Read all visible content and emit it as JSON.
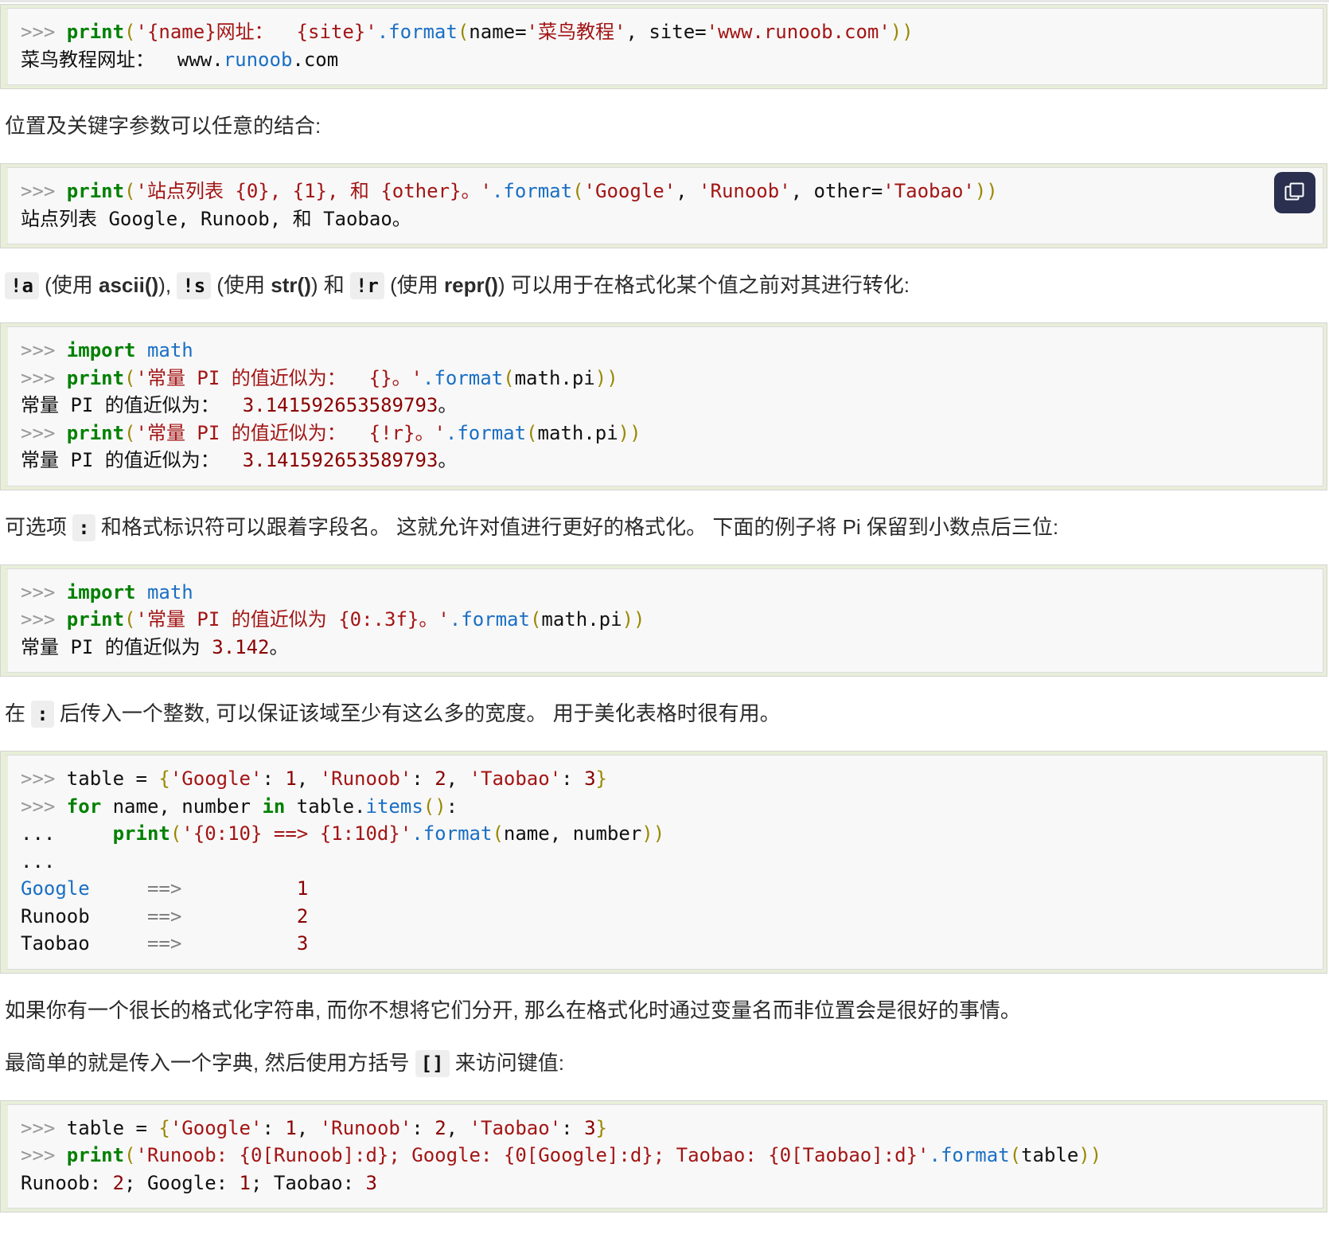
{
  "page": {
    "title": "Python format 字符串格式化教程片段",
    "background": "#ffffff",
    "code_block_frame_color": "#e8eed8",
    "code_block_inner_color": "#f8f8f8",
    "accent_copy_button_color": "#2b3050"
  },
  "colors": {
    "prompt": "#999999",
    "keyword": "#008000",
    "string": "#a31515",
    "method": "#1a6fc4",
    "paren": "#998800",
    "number": "#8b0000",
    "arrow": "#808080",
    "link": "#1a6fc4",
    "inline_code_bg": "#eeeeee"
  },
  "blocks": [
    {
      "id": "code-1",
      "type": "code",
      "has_copy_button": false,
      "lines": [
        {
          "tokens": [
            {
              "t": ">>> ",
              "c": "prompt"
            },
            {
              "t": "print",
              "c": "fn"
            },
            {
              "t": "(",
              "c": "paren"
            },
            {
              "t": "'{name}网址：  {site}'",
              "c": "str"
            },
            {
              "t": ".format",
              "c": "meth"
            },
            {
              "t": "(",
              "c": "paren"
            },
            {
              "t": "name=",
              "c": "plain"
            },
            {
              "t": "'菜鸟教程'",
              "c": "str"
            },
            {
              "t": ", ",
              "c": "punct"
            },
            {
              "t": "site=",
              "c": "plain"
            },
            {
              "t": "'www.runoob.com'",
              "c": "str"
            },
            {
              "t": "))",
              "c": "paren"
            }
          ]
        },
        {
          "tokens": [
            {
              "t": "菜鸟教程网址：  ",
              "c": "plain"
            },
            {
              "t": "www.",
              "c": "plain"
            },
            {
              "t": "runoob",
              "c": "link"
            },
            {
              "t": ".com",
              "c": "plain"
            }
          ]
        }
      ]
    },
    {
      "id": "para-1",
      "type": "paragraph",
      "segments": [
        {
          "t": "位置及关键字参数可以任意的结合:",
          "k": "text"
        }
      ]
    },
    {
      "id": "code-2",
      "type": "code",
      "has_copy_button": true,
      "copy_icon": "copy-icon",
      "lines": [
        {
          "tokens": [
            {
              "t": ">>> ",
              "c": "prompt"
            },
            {
              "t": "print",
              "c": "fn"
            },
            {
              "t": "(",
              "c": "paren"
            },
            {
              "t": "'站点列表 {0}, {1}, 和 {other}。'",
              "c": "str"
            },
            {
              "t": ".format",
              "c": "meth"
            },
            {
              "t": "(",
              "c": "paren"
            },
            {
              "t": "'Google'",
              "c": "str"
            },
            {
              "t": ", ",
              "c": "punct"
            },
            {
              "t": "'Runoob'",
              "c": "str"
            },
            {
              "t": ", ",
              "c": "punct"
            },
            {
              "t": "other=",
              "c": "plain"
            },
            {
              "t": "'Taobao'",
              "c": "str"
            },
            {
              "t": "))",
              "c": "paren"
            }
          ]
        },
        {
          "tokens": [
            {
              "t": "站点列表 Google, Runoob, 和 Taobao。",
              "c": "plain"
            }
          ]
        }
      ]
    },
    {
      "id": "para-2",
      "type": "paragraph",
      "segments": [
        {
          "t": "!a",
          "k": "code"
        },
        {
          "t": " (使用 ",
          "k": "text"
        },
        {
          "t": "ascii()",
          "k": "bold"
        },
        {
          "t": "), ",
          "k": "text"
        },
        {
          "t": "!s",
          "k": "code"
        },
        {
          "t": " (使用 ",
          "k": "text"
        },
        {
          "t": "str()",
          "k": "bold"
        },
        {
          "t": ") 和 ",
          "k": "text"
        },
        {
          "t": "!r",
          "k": "code"
        },
        {
          "t": " (使用 ",
          "k": "text"
        },
        {
          "t": "repr()",
          "k": "bold"
        },
        {
          "t": ") 可以用于在格式化某个值之前对其进行转化:",
          "k": "text"
        }
      ]
    },
    {
      "id": "code-3",
      "type": "code",
      "has_copy_button": false,
      "lines": [
        {
          "tokens": [
            {
              "t": ">>> ",
              "c": "prompt"
            },
            {
              "t": "import",
              "c": "kw"
            },
            {
              "t": " ",
              "c": "plain"
            },
            {
              "t": "math",
              "c": "meth"
            }
          ]
        },
        {
          "tokens": [
            {
              "t": ">>> ",
              "c": "prompt"
            },
            {
              "t": "print",
              "c": "fn"
            },
            {
              "t": "(",
              "c": "paren"
            },
            {
              "t": "'常量 PI 的值近似为：  {}。'",
              "c": "str"
            },
            {
              "t": ".format",
              "c": "meth"
            },
            {
              "t": "(",
              "c": "paren"
            },
            {
              "t": "math.pi",
              "c": "plain"
            },
            {
              "t": "))",
              "c": "paren"
            }
          ]
        },
        {
          "tokens": [
            {
              "t": "常量 PI 的值近似为：  ",
              "c": "plain"
            },
            {
              "t": "3.141592653589793",
              "c": "outnum"
            },
            {
              "t": "。",
              "c": "plain"
            }
          ]
        },
        {
          "tokens": [
            {
              "t": ">>> ",
              "c": "prompt"
            },
            {
              "t": "print",
              "c": "fn"
            },
            {
              "t": "(",
              "c": "paren"
            },
            {
              "t": "'常量 PI 的值近似为：  {!r}。'",
              "c": "str"
            },
            {
              "t": ".format",
              "c": "meth"
            },
            {
              "t": "(",
              "c": "paren"
            },
            {
              "t": "math.pi",
              "c": "plain"
            },
            {
              "t": "))",
              "c": "paren"
            }
          ]
        },
        {
          "tokens": [
            {
              "t": "常量 PI 的值近似为：  ",
              "c": "plain"
            },
            {
              "t": "3.141592653589793",
              "c": "outnum"
            },
            {
              "t": "。",
              "c": "plain"
            }
          ]
        }
      ]
    },
    {
      "id": "para-3",
      "type": "paragraph",
      "segments": [
        {
          "t": "可选项 ",
          "k": "text"
        },
        {
          "t": ":",
          "k": "code"
        },
        {
          "t": " 和格式标识符可以跟着字段名。 这就允许对值进行更好的格式化。 下面的例子将 Pi 保留到小数点后三位:",
          "k": "text"
        }
      ]
    },
    {
      "id": "code-4",
      "type": "code",
      "has_copy_button": false,
      "lines": [
        {
          "tokens": [
            {
              "t": ">>> ",
              "c": "prompt"
            },
            {
              "t": "import",
              "c": "kw"
            },
            {
              "t": " ",
              "c": "plain"
            },
            {
              "t": "math",
              "c": "meth"
            }
          ]
        },
        {
          "tokens": [
            {
              "t": ">>> ",
              "c": "prompt"
            },
            {
              "t": "print",
              "c": "fn"
            },
            {
              "t": "(",
              "c": "paren"
            },
            {
              "t": "'常量 PI 的值近似为 {0:.3f}。'",
              "c": "str"
            },
            {
              "t": ".format",
              "c": "meth"
            },
            {
              "t": "(",
              "c": "paren"
            },
            {
              "t": "math.pi",
              "c": "plain"
            },
            {
              "t": "))",
              "c": "paren"
            }
          ]
        },
        {
          "tokens": [
            {
              "t": "常量 PI 的值近似为 ",
              "c": "plain"
            },
            {
              "t": "3.142",
              "c": "outnum"
            },
            {
              "t": "。",
              "c": "plain"
            }
          ]
        }
      ]
    },
    {
      "id": "para-4",
      "type": "paragraph",
      "segments": [
        {
          "t": "在 ",
          "k": "text"
        },
        {
          "t": ":",
          "k": "code"
        },
        {
          "t": " 后传入一个整数, 可以保证该域至少有这么多的宽度。 用于美化表格时很有用。",
          "k": "text"
        }
      ]
    },
    {
      "id": "code-5",
      "type": "code",
      "has_copy_button": false,
      "lines": [
        {
          "tokens": [
            {
              "t": ">>> ",
              "c": "prompt"
            },
            {
              "t": "table = ",
              "c": "plain"
            },
            {
              "t": "{",
              "c": "paren"
            },
            {
              "t": "'Google'",
              "c": "str"
            },
            {
              "t": ": ",
              "c": "punct"
            },
            {
              "t": "1",
              "c": "num"
            },
            {
              "t": ", ",
              "c": "punct"
            },
            {
              "t": "'Runoob'",
              "c": "str"
            },
            {
              "t": ": ",
              "c": "punct"
            },
            {
              "t": "2",
              "c": "num"
            },
            {
              "t": ", ",
              "c": "punct"
            },
            {
              "t": "'Taobao'",
              "c": "str"
            },
            {
              "t": ": ",
              "c": "punct"
            },
            {
              "t": "3",
              "c": "num"
            },
            {
              "t": "}",
              "c": "paren"
            }
          ]
        },
        {
          "tokens": [
            {
              "t": ">>> ",
              "c": "prompt"
            },
            {
              "t": "for",
              "c": "kw"
            },
            {
              "t": " name, number ",
              "c": "plain"
            },
            {
              "t": "in",
              "c": "kw"
            },
            {
              "t": " table.",
              "c": "plain"
            },
            {
              "t": "items",
              "c": "meth"
            },
            {
              "t": "()",
              "c": "paren"
            },
            {
              "t": ":",
              "c": "punct"
            }
          ]
        },
        {
          "tokens": [
            {
              "t": "...     ",
              "c": "plain"
            },
            {
              "t": "print",
              "c": "fn"
            },
            {
              "t": "(",
              "c": "paren"
            },
            {
              "t": "'{0:10} ==> {1:10d}'",
              "c": "str"
            },
            {
              "t": ".format",
              "c": "meth"
            },
            {
              "t": "(",
              "c": "paren"
            },
            {
              "t": "name, number",
              "c": "plain"
            },
            {
              "t": "))",
              "c": "paren"
            }
          ]
        },
        {
          "tokens": [
            {
              "t": "...",
              "c": "plain"
            }
          ]
        },
        {
          "tokens": [
            {
              "t": "Google",
              "c": "link"
            },
            {
              "t": "     ",
              "c": "plain"
            },
            {
              "t": "==>",
              "c": "arrow"
            },
            {
              "t": "          ",
              "c": "plain"
            },
            {
              "t": "1",
              "c": "outnum"
            }
          ]
        },
        {
          "tokens": [
            {
              "t": "Runoob",
              "c": "plain"
            },
            {
              "t": "     ",
              "c": "plain"
            },
            {
              "t": "==>",
              "c": "arrow"
            },
            {
              "t": "          ",
              "c": "plain"
            },
            {
              "t": "2",
              "c": "outnum"
            }
          ]
        },
        {
          "tokens": [
            {
              "t": "Taobao",
              "c": "plain"
            },
            {
              "t": "     ",
              "c": "plain"
            },
            {
              "t": "==>",
              "c": "arrow"
            },
            {
              "t": "          ",
              "c": "plain"
            },
            {
              "t": "3",
              "c": "outnum"
            }
          ]
        }
      ]
    },
    {
      "id": "para-5",
      "type": "paragraph",
      "segments": [
        {
          "t": "如果你有一个很长的格式化字符串, 而你不想将它们分开, 那么在格式化时通过变量名而非位置会是很好的事情。",
          "k": "text"
        }
      ]
    },
    {
      "id": "para-6",
      "type": "paragraph",
      "segments": [
        {
          "t": "最简单的就是传入一个字典, 然后使用方括号 ",
          "k": "text"
        },
        {
          "t": "[]",
          "k": "code"
        },
        {
          "t": " 来访问键值:",
          "k": "text"
        }
      ]
    },
    {
      "id": "code-6",
      "type": "code",
      "has_copy_button": false,
      "lines": [
        {
          "tokens": [
            {
              "t": ">>> ",
              "c": "prompt"
            },
            {
              "t": "table = ",
              "c": "plain"
            },
            {
              "t": "{",
              "c": "paren"
            },
            {
              "t": "'Google'",
              "c": "str"
            },
            {
              "t": ": ",
              "c": "punct"
            },
            {
              "t": "1",
              "c": "num"
            },
            {
              "t": ", ",
              "c": "punct"
            },
            {
              "t": "'Runoob'",
              "c": "str"
            },
            {
              "t": ": ",
              "c": "punct"
            },
            {
              "t": "2",
              "c": "num"
            },
            {
              "t": ", ",
              "c": "punct"
            },
            {
              "t": "'Taobao'",
              "c": "str"
            },
            {
              "t": ": ",
              "c": "punct"
            },
            {
              "t": "3",
              "c": "num"
            },
            {
              "t": "}",
              "c": "paren"
            }
          ]
        },
        {
          "tokens": [
            {
              "t": ">>> ",
              "c": "prompt"
            },
            {
              "t": "print",
              "c": "fn"
            },
            {
              "t": "(",
              "c": "paren"
            },
            {
              "t": "'Runoob: {0[Runoob]:d}; Google: {0[Google]:d}; Taobao: {0[Taobao]:d}'",
              "c": "str"
            },
            {
              "t": ".format",
              "c": "meth"
            },
            {
              "t": "(",
              "c": "paren"
            },
            {
              "t": "table",
              "c": "plain"
            },
            {
              "t": "))",
              "c": "paren"
            }
          ]
        },
        {
          "tokens": [
            {
              "t": "Runoob: ",
              "c": "plain"
            },
            {
              "t": "2",
              "c": "outnum"
            },
            {
              "t": "; Google: ",
              "c": "plain"
            },
            {
              "t": "1",
              "c": "outnum"
            },
            {
              "t": "; Taobao: ",
              "c": "plain"
            },
            {
              "t": "3",
              "c": "outnum"
            }
          ]
        }
      ]
    }
  ]
}
